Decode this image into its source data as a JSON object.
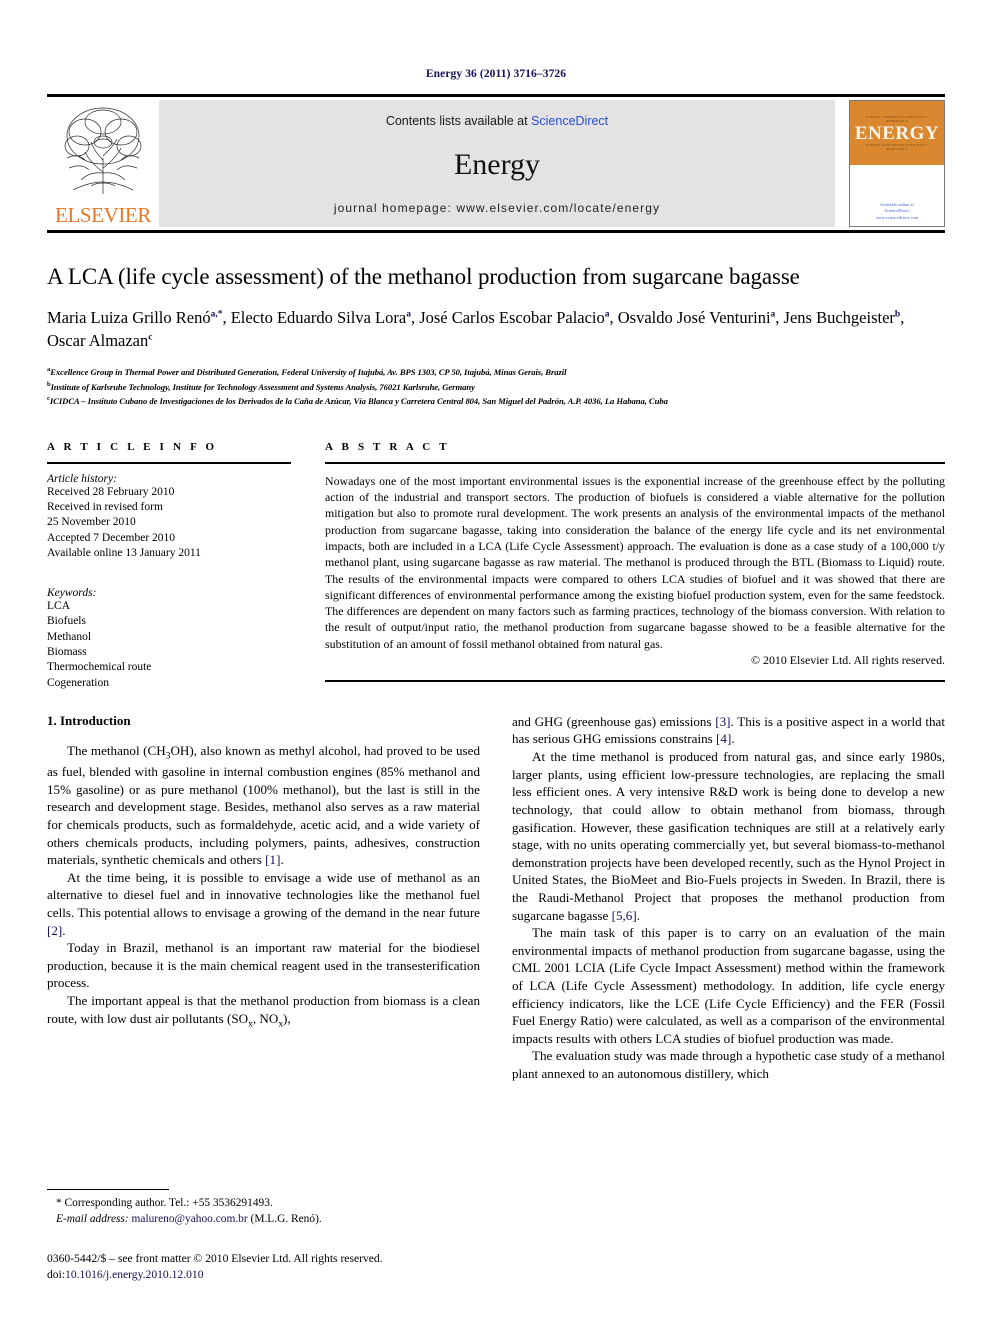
{
  "running_head": "Energy 36 (2011) 3716–3726",
  "masthead": {
    "contents_prefix": "Contents lists available at ",
    "sciencedirect": "ScienceDirect",
    "journal_name": "Energy",
    "homepage": "journal homepage: www.elsevier.com/locate/energy",
    "publisher_wordmark": "ELSEVIER",
    "cover_title": "ENERGY",
    "cover_microtext": "ENERGY CONVERSION EFFICIENCY RENEWABLE",
    "cover_footer": "Available online at\nScienceDirect\nwww.sciencedirect.com",
    "accent_orange": "#E87722",
    "link_blue": "#2a4fd8"
  },
  "title": "A LCA (life cycle assessment) of the methanol production from sugarcane bagasse",
  "authors": [
    {
      "name": "Maria Luiza Grillo Renó",
      "marks": "a,*"
    },
    {
      "name": "Electo Eduardo Silva Lora",
      "marks": "a"
    },
    {
      "name": "José Carlos Escobar Palacio",
      "marks": "a"
    },
    {
      "name": "Osvaldo José Venturini",
      "marks": "a"
    },
    {
      "name": "Jens Buchgeister",
      "marks": "b"
    },
    {
      "name": "Oscar Almazan",
      "marks": "c"
    }
  ],
  "affiliations": [
    {
      "mark": "a",
      "text": "Excellence Group in Thermal Power and Distributed Generation, Federal University of Itajubá, Av. BPS 1303, CP 50, Itajubá, Minas Gerais, Brazil"
    },
    {
      "mark": "b",
      "text": "Institute of Karlsruhe Technology, Institute for Technology Assessment and Systems Analysis, 76021 Karlsruhe, Germany"
    },
    {
      "mark": "c",
      "text": "ICIDCA – Instituto Cubano de Investigaciones de los Derivados de la Caña de Azúcar, Vía Blanca y Carretera Central 804, San Miguel del Padrón, A.P. 4036, La Habana, Cuba"
    }
  ],
  "article_info": {
    "heading": "A R T I C L E  I N F O",
    "history_label": "Article history:",
    "history": [
      "Received 28 February 2010",
      "Received in revised form",
      "25 November 2010",
      "Accepted 7 December 2010",
      "Available online 13 January 2011"
    ],
    "keywords_label": "Keywords:",
    "keywords": [
      "LCA",
      "Biofuels",
      "Methanol",
      "Biomass",
      "Thermochemical route",
      "Cogeneration"
    ]
  },
  "abstract": {
    "heading": "A B S T R A C T",
    "text": "Nowadays one of the most important environmental issues is the exponential increase of the greenhouse effect by the polluting action of the industrial and transport sectors. The production of biofuels is considered a viable alternative for the pollution mitigation but also to promote rural development. The work presents an analysis of the environmental impacts of the methanol production from sugarcane bagasse, taking into consideration the balance of the energy life cycle and its net environmental impacts, both are included in a LCA (Life Cycle Assessment) approach. The evaluation is done as a case study of a 100,000 t/y methanol plant, using sugarcane bagasse as raw material. The methanol is produced through the BTL (Biomass to Liquid) route. The results of the environmental impacts were compared to others LCA studies of biofuel and it was showed that there are significant differences of environmental performance among the existing biofuel production system, even for the same feedstock. The differences are dependent on many factors such as farming practices, technology of the biomass conversion. With relation to the result of output/input ratio, the methanol production from sugarcane bagasse showed to be a feasible alternative for the substitution of an amount of fossil methanol obtained from natural gas.",
    "copyright": "© 2010 Elsevier Ltd. All rights reserved."
  },
  "body": {
    "section_number_title": "1. Introduction",
    "left_paragraphs": [
      "The methanol (CH3OH), also known as methyl alcohol, had proved to be used as fuel, blended with gasoline in internal combustion engines (85% methanol and 15% gasoline) or as pure methanol (100% methanol), but the last is still in the research and development stage. Besides, methanol also serves as a raw material for chemicals products, such as formaldehyde, acetic acid, and a wide variety of others chemicals products, including polymers, paints, adhesives, construction materials, synthetic chemicals and others [1].",
      "At the time being, it is possible to envisage a wide use of methanol as an alternative to diesel fuel and in innovative technologies like the methanol fuel cells. This potential allows to envisage a growing of the demand in the near future [2].",
      "Today in Brazil, methanol is an important raw material for the biodiesel production, because it is the main chemical reagent used in the transesterification process.",
      "The important appeal is that the methanol production from biomass is a clean route, with low dust air pollutants (SOx, NOx),"
    ],
    "right_paragraphs": [
      "and GHG (greenhouse gas) emissions [3]. This is a positive aspect in a world that has serious GHG emissions constrains [4].",
      "At the time methanol is produced from natural gas, and since early 1980s, larger plants, using efficient low-pressure technologies, are replacing the small less efficient ones. A very intensive R&D work is being done to develop a new technology, that could allow to obtain methanol from biomass, through gasification. However, these gasification techniques are still at a relatively early stage, with no units operating commercially yet, but several biomass-to-methanol demonstration projects have been developed recently, such as the Hynol Project in United States, the BioMeet and Bio-Fuels projects in Sweden. In Brazil, there is the Raudi-Methanol Project that proposes the methanol production from sugarcane bagasse [5,6].",
      "The main task of this paper is to carry on an evaluation of the main environmental impacts of methanol production from sugarcane bagasse, using the CML 2001 LCIA (Life Cycle Impact Assessment) method within the framework of LCA (Life Cycle Assessment) methodology. In addition, life cycle energy efficiency indicators, like the LCE (Life Cycle Efficiency) and the FER (Fossil Fuel Energy Ratio) were calculated, as well as a comparison of the environmental impacts results with others LCA studies of biofuel production was made.",
      "The evaluation study was made through a hypothetic case study of a methanol plant annexed to an autonomous distillery, which"
    ]
  },
  "footnotes": {
    "corresponding": "* Corresponding author. Tel.: +55 3536291493.",
    "email_label": "E-mail address:",
    "email": "malureno@yahoo.com.br",
    "email_suffix": "(M.L.G. Renó)."
  },
  "footer": {
    "issn_line": "0360-5442/$ – see front matter © 2010 Elsevier Ltd. All rights reserved.",
    "doi_label": "doi:",
    "doi": "10.1016/j.energy.2010.12.010"
  }
}
